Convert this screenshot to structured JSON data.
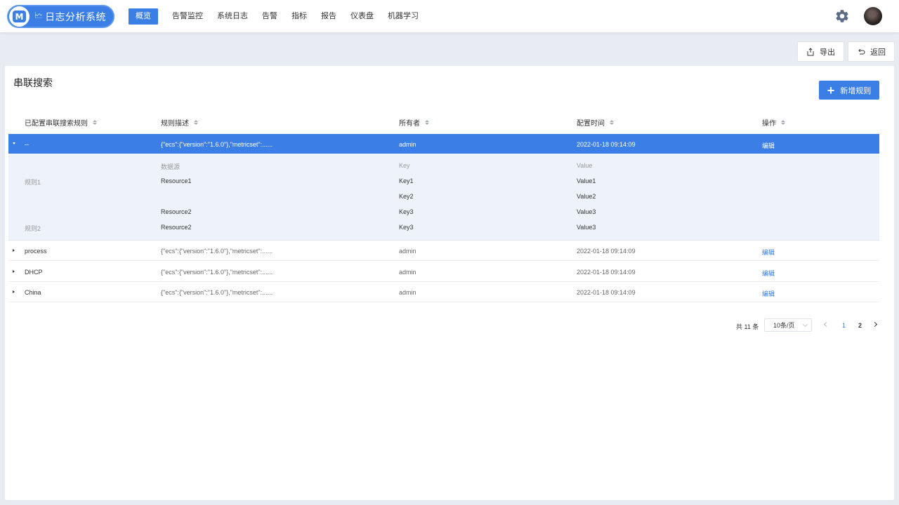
{
  "app": {
    "title": "日志分析系统",
    "logo_mark": "M",
    "logo_sub": "🗠"
  },
  "nav": {
    "items": [
      "概览",
      "告警监控",
      "系统日志",
      "告警",
      "指标",
      "报告",
      "仪表盘",
      "机器学习"
    ],
    "active_index": 0
  },
  "header_icons": [
    "gear-icon",
    "avatar"
  ],
  "actions": {
    "export_label": "导出",
    "back_label": "返回"
  },
  "page": {
    "title": "串联搜索",
    "add_button_label": "新增规则",
    "add_icon": "+"
  },
  "table": {
    "columns": [
      "已配置串联搜索规则",
      "规则描述",
      "所有者",
      "配置时间",
      "操作"
    ],
    "rows": [
      {
        "name": "--",
        "desc": "{\"ecs\":{\"version\":\"1.6.0\"},\"metricset\":......",
        "owner": "admin",
        "time": "2022-01-18 09:14:09",
        "action": "编辑",
        "expanded": true,
        "selected": true
      },
      {
        "name": "process",
        "desc": "{\"ecs\":{\"version\":\"1.6.0\"},\"metricset\":......",
        "owner": "admin",
        "time": "2022-01-18 09:14:09",
        "action": "编辑",
        "expanded": false,
        "selected": false
      },
      {
        "name": "DHCP",
        "desc": "{\"ecs\":{\"version\":\"1.6.0\"},\"metricset\":......",
        "owner": "admin",
        "time": "2022-01-18 09:14:09",
        "action": "编辑",
        "expanded": false,
        "selected": false
      },
      {
        "name": "China",
        "desc": "{\"ecs\":{\"version\":\"1.6.0\"},\"metricset\":......",
        "owner": "admin",
        "time": "2022-01-18 09:14:09",
        "action": "编辑",
        "expanded": false,
        "selected": false
      }
    ]
  },
  "detail": {
    "headers": {
      "source": "数据源",
      "key": "Key",
      "value": "Value"
    },
    "lines": [
      {
        "rule": "规则1",
        "source": "Resource1",
        "key": "Key1",
        "value": "Value1"
      },
      {
        "rule": "",
        "source": "",
        "key": "Key2",
        "value": "Value2"
      },
      {
        "rule": "",
        "source": "Resource2",
        "key": "Key3",
        "value": "Value3"
      },
      {
        "rule": "规则2",
        "source": "Resource2",
        "key": "Key3",
        "value": "Value3"
      }
    ]
  },
  "pagination": {
    "total_text": "共 11 条",
    "page_size": "10条/页",
    "pages": [
      "1",
      "2"
    ],
    "current_page": "2"
  },
  "colors": {
    "primary": "#3a7ee6",
    "link": "#2f7be3",
    "page_bg": "#e8ebf2",
    "expand_bg": "#eef3fb"
  }
}
